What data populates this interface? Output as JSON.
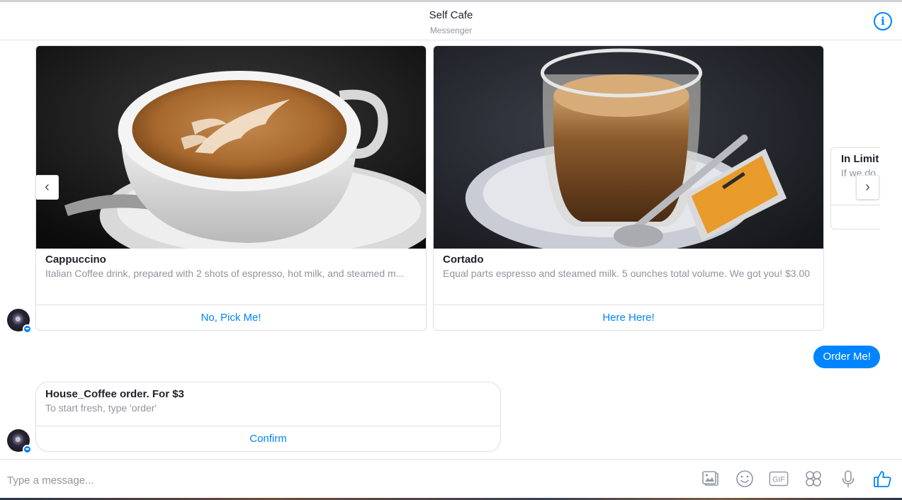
{
  "header": {
    "title": "Self Cafe",
    "subtitle": "Messenger",
    "info_icon": "info-icon"
  },
  "carousel": {
    "cards": [
      {
        "title": "Cappuccino",
        "subtitle": "Italian Coffee drink, prepared with 2 shots of espresso, hot milk, and steamed m...",
        "button": "No, Pick Me!",
        "image": "cappuccino-photo"
      },
      {
        "title": "Cortado",
        "subtitle": "Equal parts espresso and steamed milk. 5 ounches total volume. We got you! $3.00",
        "button": "Here Here!",
        "image": "cortado-photo"
      },
      {
        "title": "In Limit",
        "subtitle": "If we do"
      }
    ],
    "prev_icon": "chevron-left-icon",
    "next_icon": "chevron-right-icon"
  },
  "outgoing": {
    "text": "Order Me!"
  },
  "receipt": {
    "title": "House_Coffee order. For $3",
    "subtitle": "To start fresh, type 'order'",
    "button": "Confirm"
  },
  "composer": {
    "placeholder": "Type a message...",
    "tools": [
      "photo-icon",
      "emoji-icon",
      "gif-icon",
      "sticker-icon",
      "microphone-icon",
      "thumbs-up-icon"
    ],
    "gif_label": "GIF",
    "accent": "#0084ff"
  }
}
